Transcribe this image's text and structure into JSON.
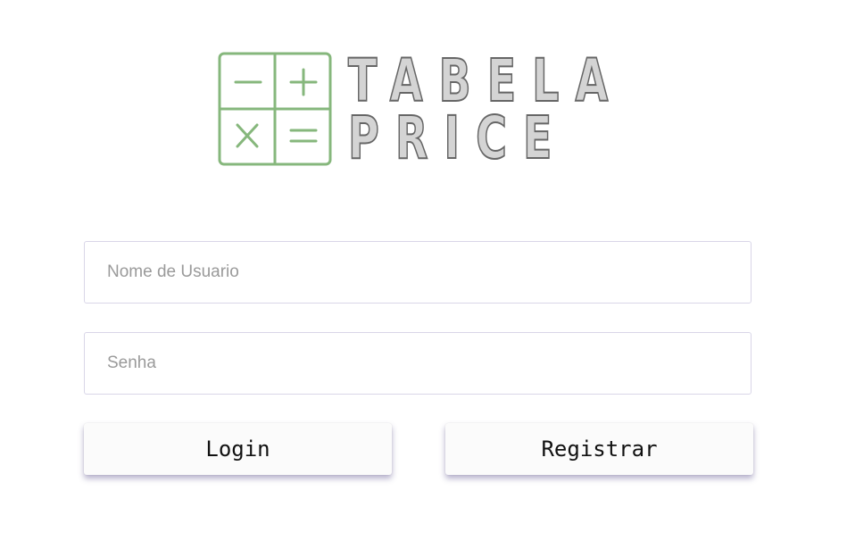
{
  "logo": {
    "line1": "TABELA",
    "line2": "PRICE",
    "grid_color": "#86b77c"
  },
  "form": {
    "username_placeholder": "Nome de Usuario",
    "password_placeholder": "Senha",
    "username_value": "",
    "password_value": ""
  },
  "actions": {
    "login_label": "Login",
    "register_label": "Registrar"
  }
}
